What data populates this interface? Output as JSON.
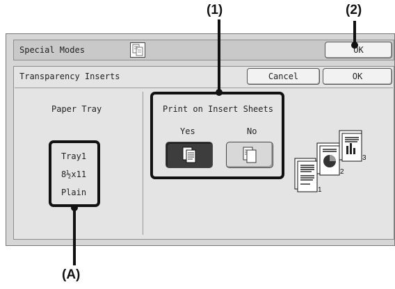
{
  "callouts": {
    "one": "(1)",
    "two": "(2)",
    "a": "(A)"
  },
  "titlebar": {
    "title": "Special Modes",
    "ok_label": "OK",
    "mode_icon": "document-stack-icon"
  },
  "screen": {
    "title": "Transparency Inserts",
    "cancel_label": "Cancel",
    "ok_label": "OK"
  },
  "paper_tray": {
    "heading": "Paper Tray",
    "tray": "Tray1",
    "size": "8½x11",
    "type": "Plain"
  },
  "print_insert": {
    "heading": "Print on Insert Sheets",
    "yes_label": "Yes",
    "no_label": "No",
    "selected": "Yes",
    "yes_icon": "printed-insert-icon",
    "no_icon": "blank-insert-icon"
  },
  "illustration": {
    "name": "transparency-pages-illustration",
    "page_numbers": [
      "1",
      "2",
      "3"
    ]
  },
  "colors": {
    "panel": "#d6d6d6",
    "selected_button": "#3d3d3d",
    "callout": "#111111"
  }
}
